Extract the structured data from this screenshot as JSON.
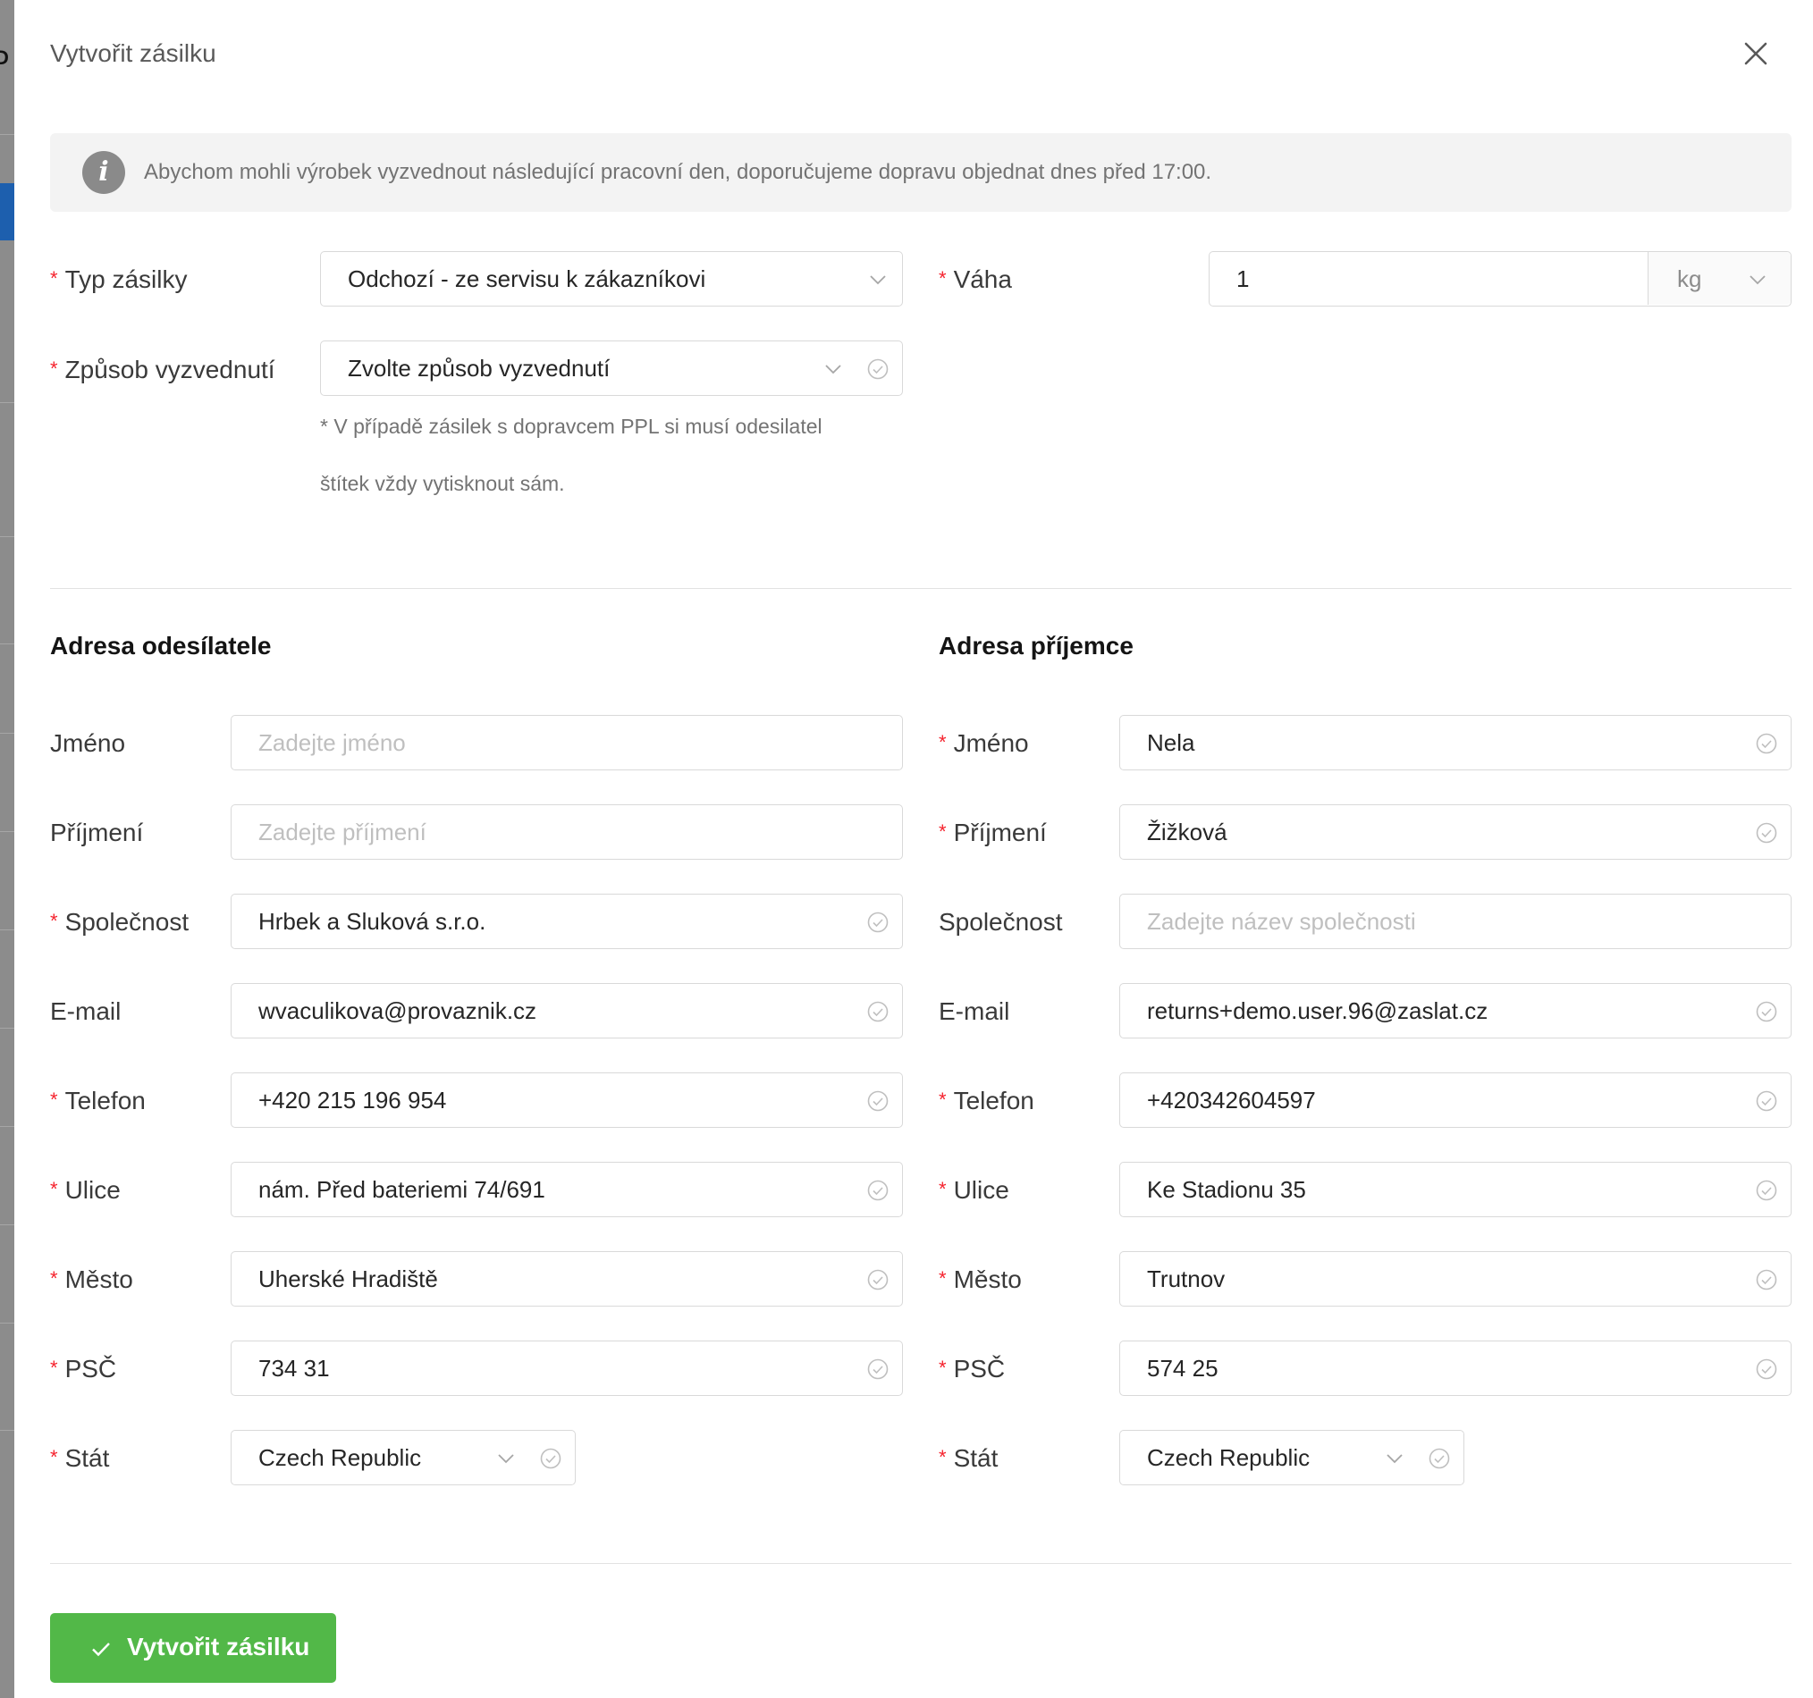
{
  "drawer": {
    "title": "Vytvořit zásilku"
  },
  "info": {
    "text": "Abychom mohli výrobek vyzvednout následující pracovní den, doporučujeme dopravu objednat dnes před 17:00."
  },
  "shipment": {
    "type_label": "Typ zásilky",
    "type_value": "Odchozí - ze servisu k zákazníkovi",
    "pickup_label": "Způsob vyzvednutí",
    "pickup_placeholder": "Zvolte způsob vyzvednutí",
    "pickup_note_line1": "* V případě zásilek s dopravcem PPL si musí odesilatel",
    "pickup_note_line2": "štítek vždy vytisknout sám.",
    "weight_label": "Váha",
    "weight_value": "1",
    "weight_unit": "kg"
  },
  "sender": {
    "title": "Adresa odesílatele",
    "first_name_label": "Jméno",
    "first_name_placeholder": "Zadejte jméno",
    "last_name_label": "Příjmení",
    "last_name_placeholder": "Zadejte příjmení",
    "company_label": "Společnost",
    "company_value": "Hrbek a Sluková s.r.o.",
    "email_label": "E-mail",
    "email_value": "wvaculikova@provaznik.cz",
    "phone_label": "Telefon",
    "phone_value": "+420 215 196 954",
    "street_label": "Ulice",
    "street_value": "nám. Před bateriemi 74/691",
    "city_label": "Město",
    "city_value": "Uherské Hradiště",
    "zip_label": "PSČ",
    "zip_value": "734 31",
    "country_label": "Stát",
    "country_value": "Czech Republic"
  },
  "recipient": {
    "title": "Adresa příjemce",
    "first_name_label": "Jméno",
    "first_name_value": "Nela",
    "last_name_label": "Příjmení",
    "last_name_value": "Žižková",
    "company_label": "Společnost",
    "company_placeholder": "Zadejte název společnosti",
    "email_label": "E-mail",
    "email_value": "returns+demo.user.96@zaslat.cz",
    "phone_label": "Telefon",
    "phone_value": "+420342604597",
    "street_label": "Ulice",
    "street_value": "Ke Stadionu 35",
    "city_label": "Město",
    "city_value": "Trutnov",
    "zip_label": "PSČ",
    "zip_value": "574 25",
    "country_label": "Stát",
    "country_value": "Czech Republic"
  },
  "actions": {
    "submit_label": "Vytvořit zásilku"
  },
  "icons": {
    "close": "close-icon",
    "info": "info-icon",
    "chevron": "chevron-down-icon",
    "check_circle": "check-circle-icon",
    "check": "check-icon"
  },
  "colors": {
    "required": "#f5222d",
    "primary_button": "#52b848",
    "info_background": "#f3f3f3",
    "border": "#d9d9d9"
  }
}
